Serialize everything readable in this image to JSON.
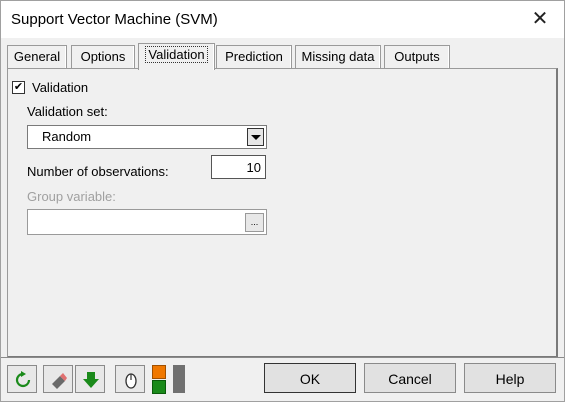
{
  "window": {
    "title": "Support Vector Machine (SVM)",
    "close_glyph": "✕"
  },
  "tabs": [
    {
      "label": "General"
    },
    {
      "label": "Options"
    },
    {
      "label": "Validation"
    },
    {
      "label": "Prediction"
    },
    {
      "label": "Missing data"
    },
    {
      "label": "Outputs"
    }
  ],
  "active_tab": "Validation",
  "validation": {
    "checkbox_label": "Validation",
    "checked": true,
    "check_glyph": "✔",
    "validation_set_label": "Validation set:",
    "validation_set_value": "Random",
    "observations_label": "Number of observations:",
    "observations_value": "10",
    "group_variable_label": "Group variable:",
    "group_variable_value": "",
    "group_button_glyph": "..."
  },
  "toolbar_icons": [
    "reset-icon",
    "eraser-icon",
    "down-arrow-icon",
    "mouse-icon",
    "color-blocks-icon"
  ],
  "buttons": {
    "ok": "OK",
    "cancel": "Cancel",
    "help": "Help"
  }
}
